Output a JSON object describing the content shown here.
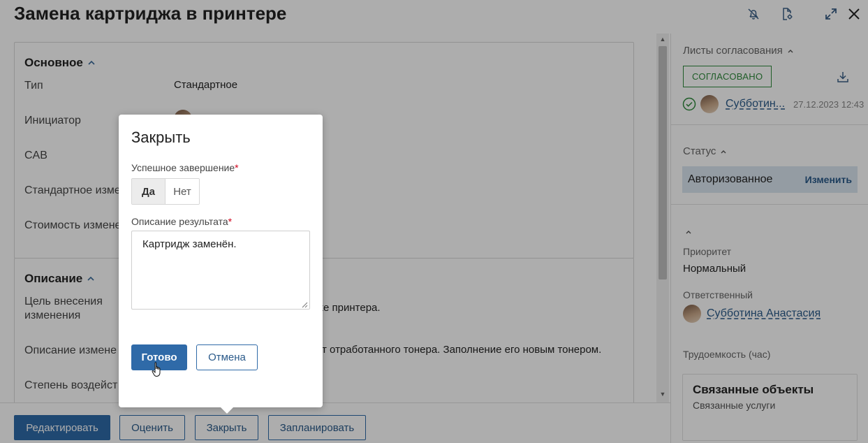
{
  "header": {
    "title": "Замена картриджа в принтере",
    "icons": [
      "notification-off-icon",
      "document-settings-icon",
      "expand-icon",
      "close-icon"
    ]
  },
  "main": {
    "section_basic": {
      "title": "Основное",
      "rows": [
        {
          "label": "Тип",
          "value": "Стандартное"
        },
        {
          "label": "Инициатор",
          "value": ""
        },
        {
          "label": "CAB",
          "value": ""
        },
        {
          "label": "Стандартное изме",
          "value": ""
        },
        {
          "label": "Стоимость измене",
          "value": ""
        }
      ]
    },
    "section_desc": {
      "title": "Описание",
      "rows": [
        {
          "label": "Цель внесения изменения",
          "value": "же принтера."
        },
        {
          "label": "Описание измене",
          "value": "от отработанного тонера. Заполнение его новым тонером."
        },
        {
          "label": "Степень воздейст",
          "value": ""
        }
      ]
    }
  },
  "sidebar": {
    "approval": {
      "title": "Листы согласования",
      "badge": "СОГЛАСОВАНО",
      "person": "Субботин...",
      "datetime": "27.12.2023 12:43"
    },
    "status": {
      "title": "Статус",
      "value": "Авторизованное",
      "change_label": "Изменить"
    },
    "fields": {
      "priority_label": "Приоритет",
      "priority_value": "Нормальный",
      "responsible_label": "Ответственный",
      "responsible_value": "Субботина Анастасия",
      "effort_label": "Трудоемкость (час)"
    },
    "linked": {
      "title": "Связанные объекты",
      "subtitle": "Связанные услуги"
    }
  },
  "bottom_bar": {
    "edit": "Редактировать",
    "rate": "Оценить",
    "close": "Закрыть",
    "plan": "Запланировать"
  },
  "dialog": {
    "title": "Закрыть",
    "success_label": "Успешное завершение",
    "yes": "Да",
    "no": "Нет",
    "result_label": "Описание результата",
    "result_value": "Картридж заменён.",
    "ok": "Готово",
    "cancel": "Отмена",
    "required_mark": "*"
  },
  "colors": {
    "accent": "#2f6aa8",
    "approved": "#2f8a3c",
    "status_bg": "#dbe6f1",
    "required": "#d0021b"
  }
}
